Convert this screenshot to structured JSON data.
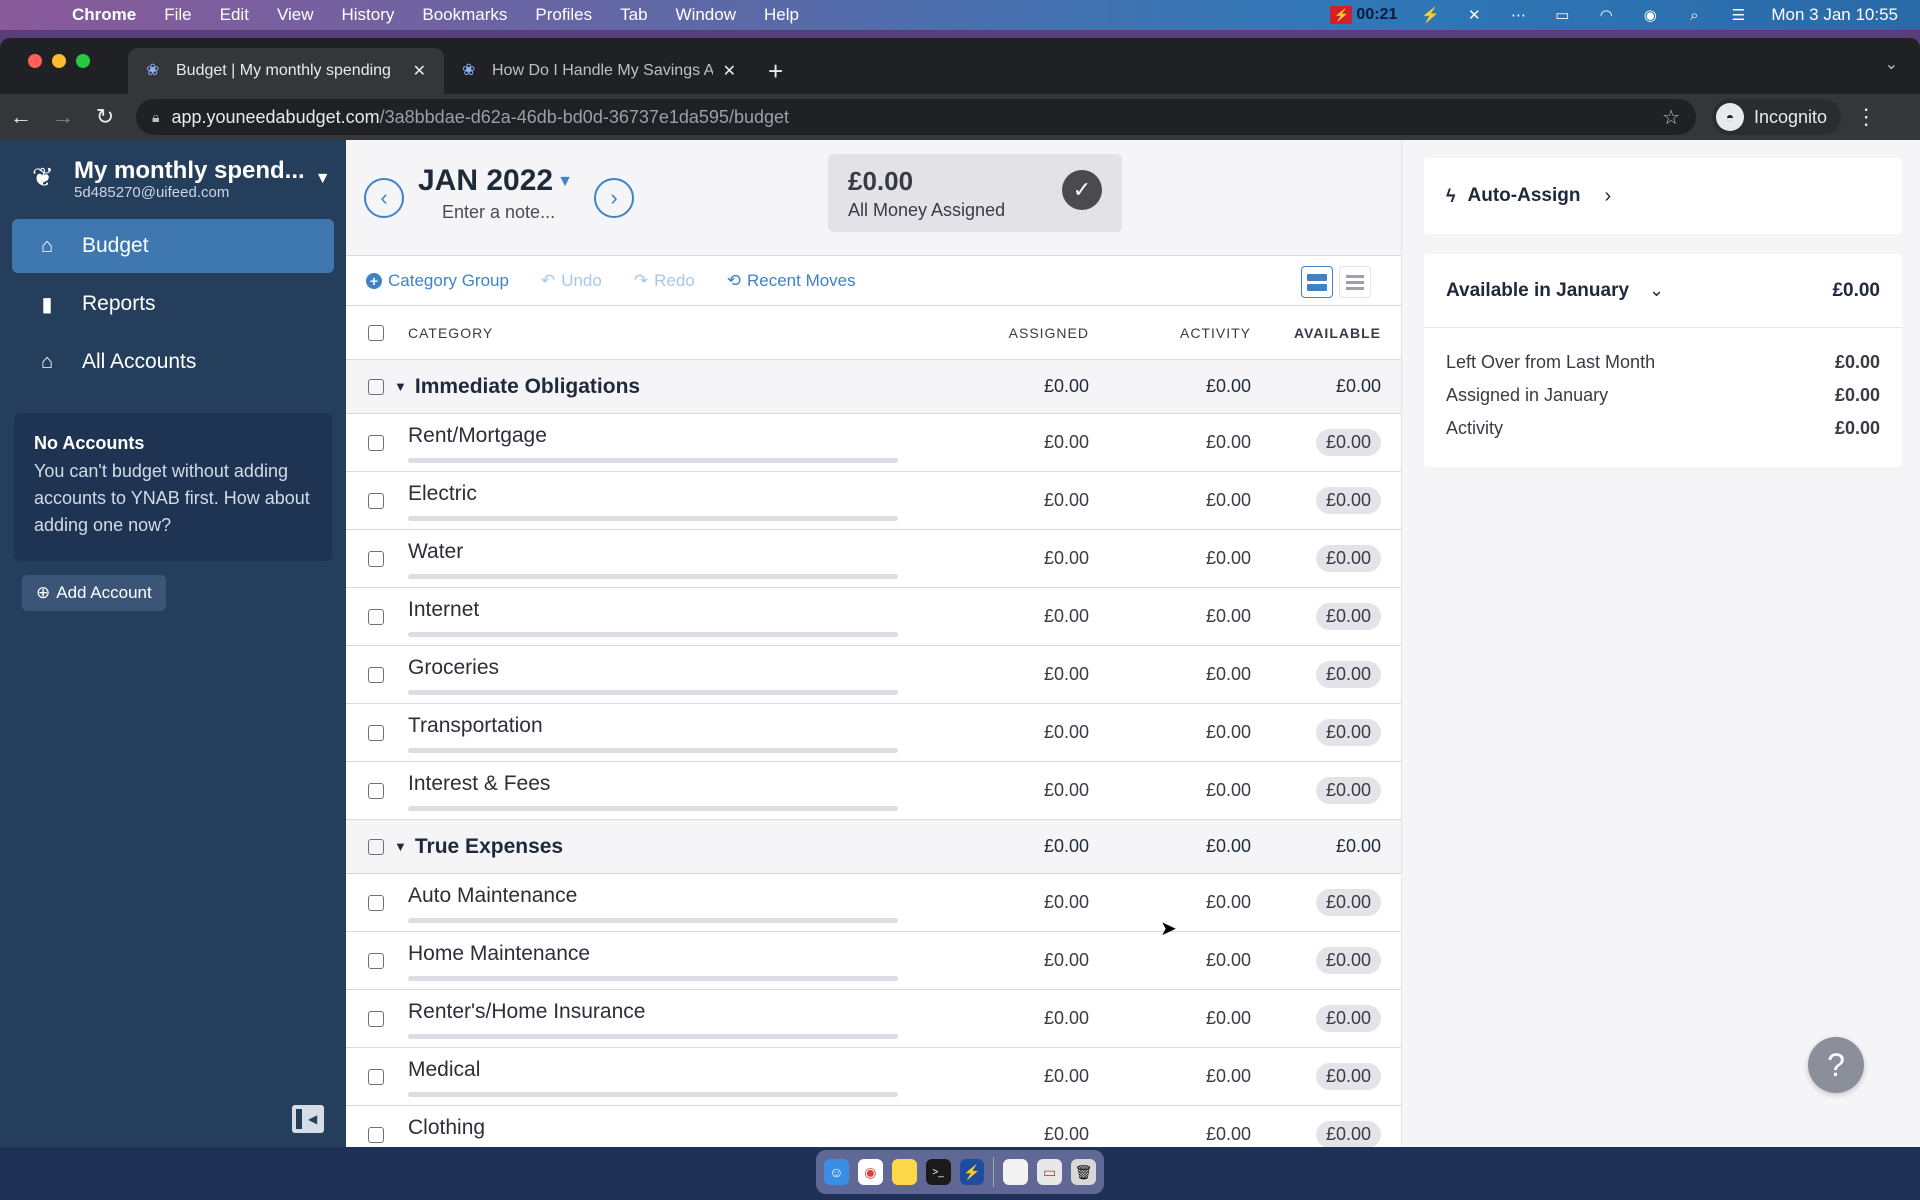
{
  "menubar": {
    "app_name": "Chrome",
    "items": [
      "File",
      "Edit",
      "View",
      "History",
      "Bookmarks",
      "Profiles",
      "Tab",
      "Window",
      "Help"
    ],
    "recording_time": "00:21",
    "datetime": "Mon 3 Jan  10:55"
  },
  "browser": {
    "tabs": [
      {
        "title": "Budget | My monthly spending",
        "active": true
      },
      {
        "title": "How Do I Handle My Savings A",
        "active": false
      }
    ],
    "url_host": "app.youneedabudget.com",
    "url_path": "/3a8bbdae-d62a-46db-bd0d-36737e1da595/budget",
    "profile_label": "Incognito"
  },
  "sidebar": {
    "budget_name": "My monthly spend...",
    "email": "5d485270@uifeed.com",
    "nav": [
      {
        "label": "Budget",
        "icon": "budget-icon",
        "active": true
      },
      {
        "label": "Reports",
        "icon": "reports-icon",
        "active": false
      },
      {
        "label": "All Accounts",
        "icon": "bank-icon",
        "active": false
      }
    ],
    "no_accounts_title": "No Accounts",
    "no_accounts_text": "You can't budget without adding accounts to YNAB first. How about adding one now?",
    "add_account_label": "Add Account"
  },
  "header": {
    "month": "JAN 2022",
    "note_placeholder": "Enter a note...",
    "to_be_assigned_amount": "£0.00",
    "to_be_assigned_label": "All Money Assigned"
  },
  "toolbar": {
    "category_group": "Category Group",
    "undo": "Undo",
    "redo": "Redo",
    "recent_moves": "Recent Moves"
  },
  "table": {
    "columns": [
      "CATEGORY",
      "ASSIGNED",
      "ACTIVITY",
      "AVAILABLE"
    ],
    "groups": [
      {
        "name": "Immediate Obligations",
        "assigned": "£0.00",
        "activity": "£0.00",
        "available": "£0.00",
        "categories": [
          {
            "name": "Rent/Mortgage",
            "assigned": "£0.00",
            "activity": "£0.00",
            "available": "£0.00"
          },
          {
            "name": "Electric",
            "assigned": "£0.00",
            "activity": "£0.00",
            "available": "£0.00"
          },
          {
            "name": "Water",
            "assigned": "£0.00",
            "activity": "£0.00",
            "available": "£0.00"
          },
          {
            "name": "Internet",
            "assigned": "£0.00",
            "activity": "£0.00",
            "available": "£0.00"
          },
          {
            "name": "Groceries",
            "assigned": "£0.00",
            "activity": "£0.00",
            "available": "£0.00"
          },
          {
            "name": "Transportation",
            "assigned": "£0.00",
            "activity": "£0.00",
            "available": "£0.00"
          },
          {
            "name": "Interest & Fees",
            "assigned": "£0.00",
            "activity": "£0.00",
            "available": "£0.00"
          }
        ]
      },
      {
        "name": "True Expenses",
        "assigned": "£0.00",
        "activity": "£0.00",
        "available": "£0.00",
        "categories": [
          {
            "name": "Auto Maintenance",
            "assigned": "£0.00",
            "activity": "£0.00",
            "available": "£0.00"
          },
          {
            "name": "Home Maintenance",
            "assigned": "£0.00",
            "activity": "£0.00",
            "available": "£0.00"
          },
          {
            "name": "Renter's/Home Insurance",
            "assigned": "£0.00",
            "activity": "£0.00",
            "available": "£0.00"
          },
          {
            "name": "Medical",
            "assigned": "£0.00",
            "activity": "£0.00",
            "available": "£0.00"
          },
          {
            "name": "Clothing",
            "assigned": "£0.00",
            "activity": "£0.00",
            "available": "£0.00"
          }
        ]
      }
    ]
  },
  "inspector": {
    "auto_assign_label": "Auto-Assign",
    "available_title": "Available in January",
    "available_amount": "£0.00",
    "lines": [
      {
        "label": "Left Over from Last Month",
        "value": "£0.00"
      },
      {
        "label": "Assigned in January",
        "value": "£0.00"
      },
      {
        "label": "Activity",
        "value": "£0.00"
      }
    ]
  },
  "colors": {
    "sidebar_bg": "#243e5c",
    "accent_blue": "#3f83c6",
    "active_nav": "#3f78b0"
  }
}
